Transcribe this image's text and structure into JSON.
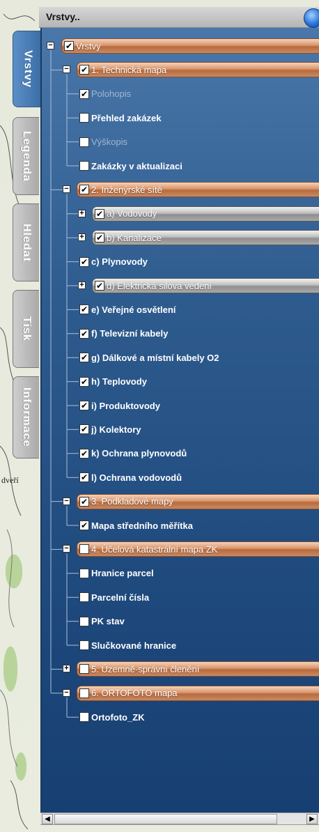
{
  "header": {
    "title": "Vrstvy.."
  },
  "tabs": [
    {
      "label": "Vrstvy",
      "active": true
    },
    {
      "label": "Legenda",
      "active": false
    },
    {
      "label": "Hledat",
      "active": false
    },
    {
      "label": "Tisk",
      "active": false
    },
    {
      "label": "Informace",
      "active": false
    }
  ],
  "map_fragment": {
    "text": "dveří"
  },
  "tree": {
    "root": {
      "label": "Vrstvy",
      "checked": true
    },
    "groups": [
      {
        "label": "1. Technická mapa",
        "checked": true,
        "expanded": true,
        "children": [
          {
            "label": "Polohopis",
            "checked": true
          },
          {
            "label": "Přehled zakázek",
            "checked": false
          },
          {
            "label": "Výškopis",
            "checked": false
          },
          {
            "label": "Zakázky v aktualizaci",
            "checked": false
          }
        ]
      },
      {
        "label": "2. Inženýrské sítě",
        "checked": true,
        "expanded": true,
        "children": [
          {
            "label": "a) Vodovody",
            "checked": true,
            "subgroup": true
          },
          {
            "label": "b) Kanalizace",
            "checked": true,
            "subgroup": true
          },
          {
            "label": "c) Plynovody",
            "checked": true
          },
          {
            "label": "d) Elektrická silová vedení",
            "checked": true,
            "subgroup": true
          },
          {
            "label": "e) Veřejné osvětlení",
            "checked": true
          },
          {
            "label": "f) Televizní kabely",
            "checked": true
          },
          {
            "label": "g) Dálkové a místní kabely O2",
            "checked": true
          },
          {
            "label": "h) Teplovody",
            "checked": true
          },
          {
            "label": "i) Produktovody",
            "checked": true
          },
          {
            "label": "j) Kolektory",
            "checked": true
          },
          {
            "label": "k) Ochrana plynovodů",
            "checked": true
          },
          {
            "label": "l) Ochrana vodovodů",
            "checked": true
          }
        ]
      },
      {
        "label": "3. Podkladové mapy",
        "checked": true,
        "expanded": true,
        "children": [
          {
            "label": "Mapa středního měřítka",
            "checked": true
          }
        ]
      },
      {
        "label": "4. Účelová katastrální mapa ZK",
        "checked": false,
        "expanded": true,
        "children": [
          {
            "label": "Hranice parcel",
            "checked": false
          },
          {
            "label": "Parcelní čísla",
            "checked": false
          },
          {
            "label": "PK stav",
            "checked": false
          },
          {
            "label": "Slučkované hranice",
            "checked": false
          }
        ]
      },
      {
        "label": "5. Územně-správní členění",
        "checked": false,
        "expanded": false,
        "children": []
      },
      {
        "label": "6. ORTOFOTO mapa",
        "checked": false,
        "expanded": true,
        "children": [
          {
            "label": "Ortofoto_ZK",
            "checked": false
          }
        ]
      }
    ]
  },
  "colors": {
    "panel_top": "#4a77aa",
    "panel_bottom": "#173f72",
    "group_bar": "#b86a3c",
    "subgroup_bar": "#8f8f8f",
    "tab_active": "#3b6da5",
    "tab_inactive": "#a9a9a9"
  }
}
